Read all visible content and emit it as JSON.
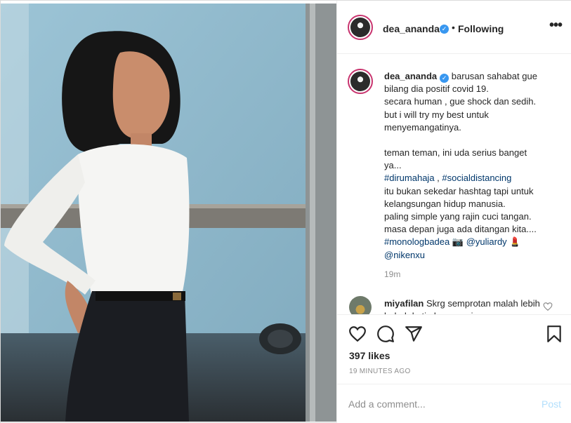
{
  "post": {
    "author": "dea_ananda",
    "follow_status": "Following",
    "separator": "•",
    "more_glyph": "•••",
    "verified_glyph": "✓"
  },
  "caption": {
    "lines": [
      "barusan sahabat gue",
      "bilang dia positif covid 19.",
      "secara human , gue shock dan sedih.",
      "but i will try my best untuk",
      "menyemangatinya.",
      "",
      "teman teman, ini uda serius banget",
      "ya...",
      "#dirumahaja , #socialdistancing",
      "itu bukan sekedar hashtag tapi untuk",
      "kelangsungan hidup manusia.",
      "paling simple yang rajin cuci tangan.",
      "masa depan juga ada ditangan kita....",
      "#monologbadea 📷 @yuliardy 💄",
      "@nikenxu"
    ],
    "hashtags": [
      "#dirumahaja",
      "#socialdistancing",
      "#monologbadea"
    ],
    "mentions": [
      "@yuliardy",
      "@nikenxu"
    ],
    "time_ago": "19m"
  },
  "comments": [
    {
      "username": "miyafilan",
      "text": "Skrg semprotan malah lebih bahah ketimbang cuci"
    }
  ],
  "actions": {
    "like_icon": "heart-icon",
    "comment_icon": "comment-icon",
    "share_icon": "share-icon",
    "save_icon": "bookmark-icon"
  },
  "likes_label": "397 likes",
  "posted_label": "19 MINUTES AGO",
  "add_comment": {
    "placeholder": "Add a comment...",
    "post_label": "Post"
  },
  "colors": {
    "link": "#00376b",
    "verified": "#3897f0",
    "post_disabled": "#b2dffc",
    "muted": "#8e8e8e"
  }
}
